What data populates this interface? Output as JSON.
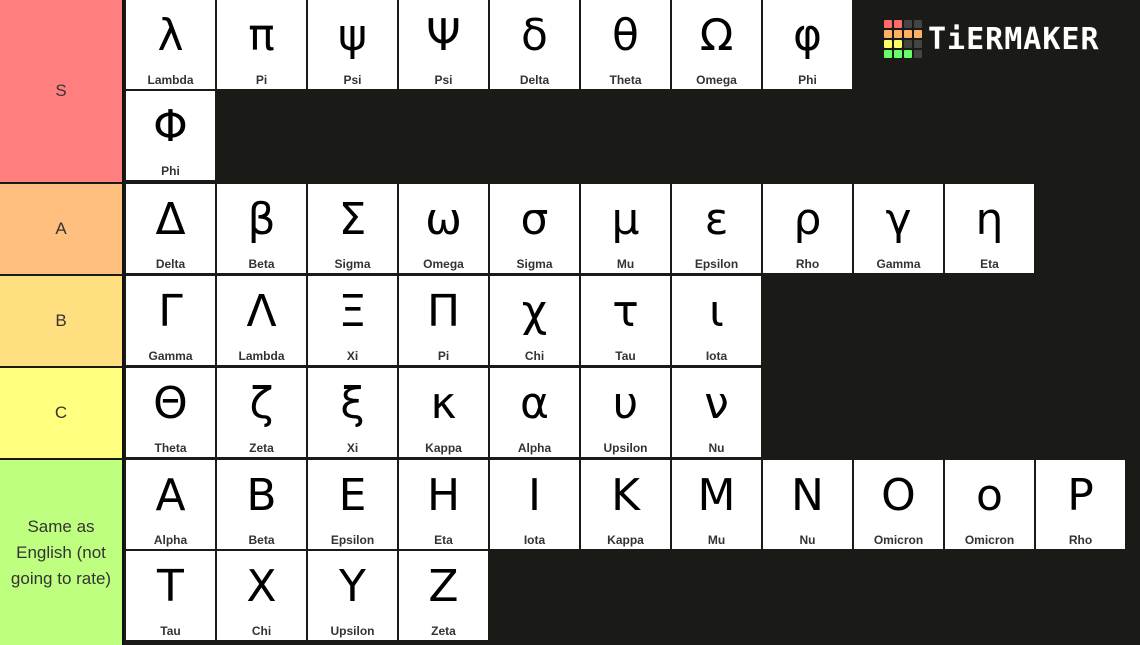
{
  "logo": {
    "text": "TiERMAKER",
    "grid_colors": [
      [
        "#ff6b6b",
        "#ff6b6b",
        "#444444",
        "#444444"
      ],
      [
        "#ffb066",
        "#ffb066",
        "#ffb066",
        "#ffb066"
      ],
      [
        "#ffff66",
        "#ffff66",
        "#444444",
        "#444444"
      ],
      [
        "#66ff66",
        "#66ff66",
        "#66ff66",
        "#444444"
      ]
    ]
  },
  "tiers": [
    {
      "label": "S",
      "color": "#ff7f7f",
      "items": [
        {
          "symbol": "λ",
          "name": "Lambda"
        },
        {
          "symbol": "π",
          "name": "Pi"
        },
        {
          "symbol": "ψ",
          "name": "Psi"
        },
        {
          "symbol": "Ψ",
          "name": "Psi"
        },
        {
          "symbol": "δ",
          "name": "Delta"
        },
        {
          "symbol": "θ",
          "name": "Theta"
        },
        {
          "symbol": "Ω",
          "name": "Omega"
        },
        {
          "symbol": "φ",
          "name": "Phi"
        },
        {
          "symbol": "Φ",
          "name": "Phi"
        }
      ]
    },
    {
      "label": "A",
      "color": "#ffbf7f",
      "items": [
        {
          "symbol": "Δ",
          "name": "Delta"
        },
        {
          "symbol": "β",
          "name": "Beta"
        },
        {
          "symbol": "Σ",
          "name": "Sigma"
        },
        {
          "symbol": "ω",
          "name": "Omega"
        },
        {
          "symbol": "σ",
          "name": "Sigma"
        },
        {
          "symbol": "μ",
          "name": "Mu"
        },
        {
          "symbol": "ε",
          "name": "Epsilon"
        },
        {
          "symbol": "ρ",
          "name": "Rho"
        },
        {
          "symbol": "γ",
          "name": "Gamma"
        },
        {
          "symbol": "η",
          "name": "Eta"
        }
      ]
    },
    {
      "label": "B",
      "color": "#ffdf7f",
      "items": [
        {
          "symbol": "Γ",
          "name": "Gamma"
        },
        {
          "symbol": "Λ",
          "name": "Lambda"
        },
        {
          "symbol": "Ξ",
          "name": "Xi"
        },
        {
          "symbol": "Π",
          "name": "Pi"
        },
        {
          "symbol": "χ",
          "name": "Chi"
        },
        {
          "symbol": "τ",
          "name": "Tau"
        },
        {
          "symbol": "ι",
          "name": "Iota"
        }
      ]
    },
    {
      "label": "C",
      "color": "#ffff7f",
      "items": [
        {
          "symbol": "Θ",
          "name": "Theta"
        },
        {
          "symbol": "ζ",
          "name": "Zeta"
        },
        {
          "symbol": "ξ",
          "name": "Xi"
        },
        {
          "symbol": "κ",
          "name": "Kappa"
        },
        {
          "symbol": "α",
          "name": "Alpha"
        },
        {
          "symbol": "υ",
          "name": "Upsilon"
        },
        {
          "symbol": "ν",
          "name": "Nu"
        }
      ]
    },
    {
      "label": "Same as English (not going to rate)",
      "color": "#bfff7f",
      "items": [
        {
          "symbol": "A",
          "name": "Alpha"
        },
        {
          "symbol": "B",
          "name": "Beta"
        },
        {
          "symbol": "E",
          "name": "Epsilon"
        },
        {
          "symbol": "H",
          "name": "Eta"
        },
        {
          "symbol": "I",
          "name": "Iota"
        },
        {
          "symbol": "K",
          "name": "Kappa"
        },
        {
          "symbol": "M",
          "name": "Mu"
        },
        {
          "symbol": "N",
          "name": "Nu"
        },
        {
          "symbol": "O",
          "name": "Omicron"
        },
        {
          "symbol": "o",
          "name": "Omicron"
        },
        {
          "symbol": "P",
          "name": "Rho"
        },
        {
          "symbol": "T",
          "name": "Tau"
        },
        {
          "symbol": "X",
          "name": "Chi"
        },
        {
          "symbol": "Y",
          "name": "Upsilon"
        },
        {
          "symbol": "Z",
          "name": "Zeta"
        }
      ]
    }
  ]
}
